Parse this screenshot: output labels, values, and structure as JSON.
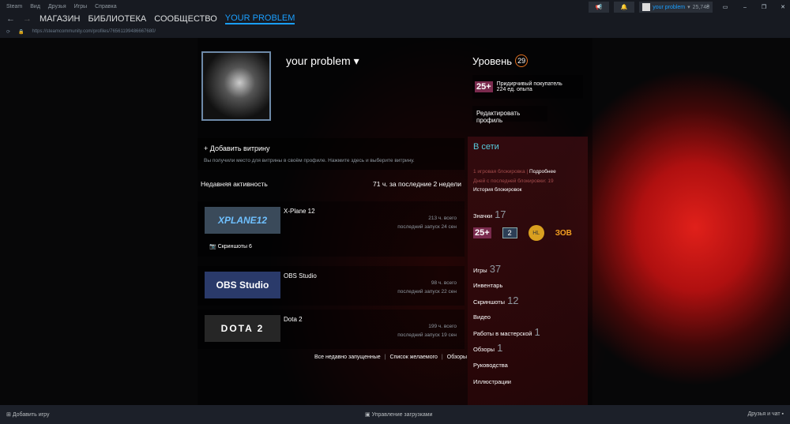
{
  "menu": [
    "Steam",
    "Вид",
    "Друзья",
    "Игры",
    "Справка"
  ],
  "nav": {
    "items": [
      "МАГАЗИН",
      "БИБЛИОТЕКА",
      "СООБЩЕСТВО"
    ],
    "active": "YOUR PROBLEM"
  },
  "url": "https://steamcommunity.com/profiles/76561199486667680/",
  "account": {
    "name": "your problem",
    "balance": "25,74₴"
  },
  "profile": {
    "name": "your problem",
    "level_label": "Уровень",
    "level": "29",
    "badge_title": "Придирчивый покупатель",
    "badge_xp": "224 ед. опыта",
    "edit": "Редактировать профиль"
  },
  "showcase": {
    "title": "+ Добавить витрину",
    "desc": "Вы получили место для витрины в своём профиле. Нажмите здесь и выберите витрину."
  },
  "activity": {
    "title": "Недавняя активность",
    "hours": "71 ч. за последние 2 недели",
    "games": [
      {
        "name": "X-Plane 12",
        "logo": "XPLANE12",
        "total": "213 ч. всего",
        "last": "последний запуск 24 сен",
        "color": "#3a4a5a"
      },
      {
        "name": "OBS Studio",
        "logo": "OBS Studio",
        "total": "98 ч. всего",
        "last": "последний запуск 22 сен",
        "color": "#2a3a6a"
      },
      {
        "name": "Dota 2",
        "logo": "DOTA 2",
        "total": "199 ч. всего",
        "last": "последний запуск 19 сен",
        "color": "#2a2a2a"
      }
    ],
    "screenshots": "Скриншоты 6",
    "links": [
      "Все недавно запущенные",
      "|",
      "Список желаемого",
      "|",
      "Обзоры"
    ]
  },
  "side": {
    "status": "В сети",
    "ban1": "1 игровая блокировка",
    "ban_more": "Подробнее",
    "ban2": "Дней с последней блокировки: 19",
    "ban_hist": "История блокировок",
    "badges_label": "Значки",
    "badges_count": "17",
    "badge_items": [
      "25+",
      "2",
      "HL",
      "ЗОВ"
    ],
    "items": [
      {
        "label": "Игры",
        "count": "37"
      },
      {
        "label": "Инвентарь",
        "count": ""
      },
      {
        "label": "Скриншоты",
        "count": "12"
      },
      {
        "label": "Видео",
        "count": ""
      },
      {
        "label": "Работы в мастерской",
        "count": "1"
      },
      {
        "label": "Обзоры",
        "count": "1"
      },
      {
        "label": "Руководства",
        "count": ""
      },
      {
        "label": "Иллюстрации",
        "count": ""
      }
    ]
  },
  "bottom": {
    "add": "Добавить игру",
    "downloads": "Управление загрузками",
    "friends": "Друзья и чат"
  }
}
